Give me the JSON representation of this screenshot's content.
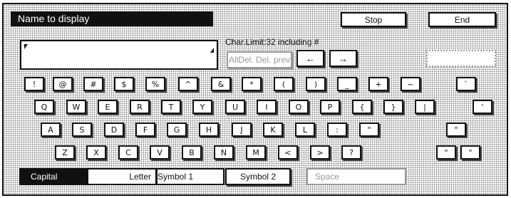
{
  "title": "Name to display",
  "stop_label": "Stop",
  "end_label": "End",
  "char_limit": "Char.Limit:32 including #",
  "alldel_label": "AllDel.",
  "del_label": "Del.",
  "prev_label": "prev",
  "left_arrow": "←",
  "right_arrow": "→",
  "rows": [
    [
      "!",
      "@",
      "#",
      "$",
      "%",
      "^",
      "&",
      "*",
      "(",
      ")",
      "_",
      "+",
      "~"
    ],
    [
      "Q",
      "W",
      "E",
      "R",
      "T",
      "Y",
      "U",
      "I",
      "O",
      "P",
      "{",
      "}",
      "|"
    ],
    [
      "A",
      "S",
      "D",
      "F",
      "G",
      "H",
      "J",
      "K",
      "L",
      ":",
      "\""
    ],
    [
      "Z",
      "X",
      "C",
      "V",
      "B",
      "N",
      "M",
      "<",
      ">",
      "?"
    ]
  ],
  "side_keys": [
    "`",
    "'",
    "\"",
    "\"",
    "\""
  ],
  "modes": {
    "capital": "Capital",
    "letter": "Letter",
    "symbol1": "Symbol 1",
    "symbol2": "Symbol 2",
    "space": "Space"
  }
}
